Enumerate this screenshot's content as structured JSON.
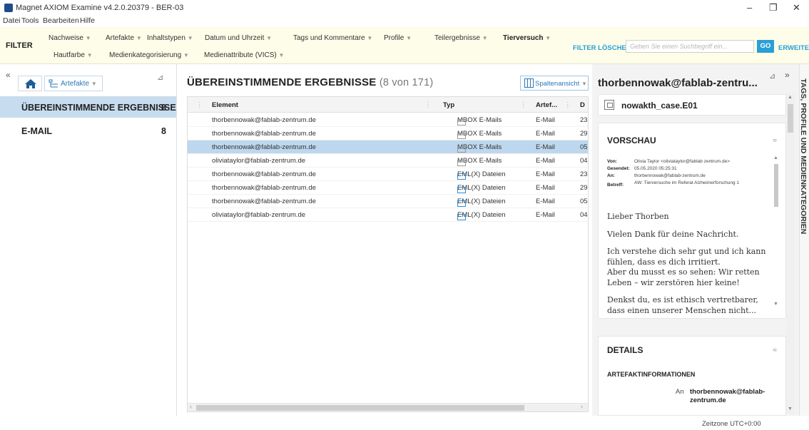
{
  "window": {
    "title": "Magnet AXIOM Examine v4.2.0.20379 - BER-03",
    "minimize": "–",
    "maximize": "❐",
    "close": "✕"
  },
  "menu": [
    "Datei",
    "Tools",
    "Bearbeiten",
    "Hilfe"
  ],
  "filter": {
    "label": "FILTER",
    "row1": [
      "Nachweise",
      "Artefakte",
      "Inhaltstypen",
      "Datum und Uhrzeit",
      "Tags und Kommentare",
      "Profile",
      "Teilergebnisse",
      "Tierversuch"
    ],
    "row2": [
      "Hautfarbe",
      "Medienkategorisierung",
      "Medienattribute (VICS)"
    ],
    "clear": "FILTER LÖSCHEN",
    "search_placeholder": "Geben Sie einen Suchbegriff ein...",
    "go": "GO",
    "extended": "ERWEITERT"
  },
  "left": {
    "collapse": "«",
    "artifacts_dropdown": "Artefakte",
    "categories": [
      {
        "label": "ÜBEREINSTIMMENDE ERGEBNISSE",
        "count": "8"
      },
      {
        "label": "E-MAIL",
        "count": "8"
      }
    ]
  },
  "middle": {
    "title": "ÜBEREINSTIMMENDE ERGEBNISSE",
    "subtitle": "(8 von 171)",
    "column_view": "Spaltenansicht",
    "columns": [
      "Element",
      "Typ",
      "Artef...",
      "D"
    ],
    "rows": [
      {
        "element": "thorbennowak@fablab-zentrum.de",
        "type": "MBOX E-Mails",
        "artifact": "E-Mail",
        "d": "23",
        "eml": false
      },
      {
        "element": "thorbennowak@fablab-zentrum.de",
        "type": "MBOX E-Mails",
        "artifact": "E-Mail",
        "d": "29",
        "eml": false
      },
      {
        "element": "thorbennowak@fablab-zentrum.de",
        "type": "MBOX E-Mails",
        "artifact": "E-Mail",
        "d": "05",
        "eml": false
      },
      {
        "element": "oliviataylor@fablab-zentrum.de",
        "type": "MBOX E-Mails",
        "artifact": "E-Mail",
        "d": "04",
        "eml": false
      },
      {
        "element": "thorbennowak@fablab-zentrum.de",
        "type": "EML(X) Dateien",
        "artifact": "E-Mail",
        "d": "23",
        "eml": true
      },
      {
        "element": "thorbennowak@fablab-zentrum.de",
        "type": "EML(X) Dateien",
        "artifact": "E-Mail",
        "d": "29",
        "eml": true
      },
      {
        "element": "thorbennowak@fablab-zentrum.de",
        "type": "EML(X) Dateien",
        "artifact": "E-Mail",
        "d": "05",
        "eml": true
      },
      {
        "element": "oliviataylor@fablab-zentrum.de",
        "type": "EML(X) Dateien",
        "artifact": "E-Mail",
        "d": "04",
        "eml": true
      }
    ],
    "selected_row": 2
  },
  "right": {
    "title": "thorbennowak@fablab-zentru...",
    "expand": "»",
    "case": "nowakth_case.E01",
    "preview": {
      "heading": "VORSCHAU",
      "from_label": "Von:",
      "from": "Olivia Taylor <oliviataylor@fablab zentrum.de>",
      "sent_label": "Gesendet:",
      "sent": "05.05.2020 05:25:31",
      "to_label": "An:",
      "to": "thorbennowak@fablab-zentrum.de",
      "subject_label": "Betreff:",
      "subject": "AW: Tierversuche im Referat Alzheimerforschung 1",
      "body": [
        "Lieber Thorben",
        "Vielen Dank für deine Nachricht.",
        "Ich verstehe dich sehr gut und ich kann fühlen, dass es dich irritiert.\nAber du musst es so sehen: Wir retten Leben – wir zerstören hier keine!",
        "Denkst du, es ist ethisch vertretbarer, dass einen unserer Menschen nicht..."
      ]
    },
    "details": {
      "heading": "DETAILS",
      "section": "ARTEFAKTINFORMATIONEN",
      "to_label": "An",
      "to_value": "thorbennowak@fablab-zentrum.de"
    }
  },
  "side_tab": "TAGS, PROFILE UND MEDIENKATEGORIEN",
  "status": "Zeitzone UTC+0:00",
  "colors": {
    "accent": "#2a9fd6",
    "selection": "#bdd7ee",
    "filter_bg": "#fdfde9"
  }
}
